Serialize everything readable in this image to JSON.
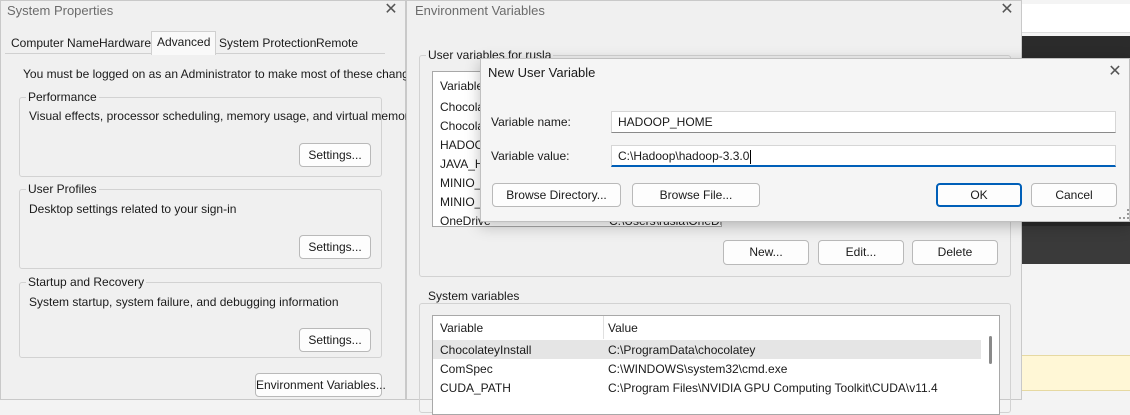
{
  "system_properties": {
    "title": "System Properties",
    "tabs": [
      "Computer Name",
      "Hardware",
      "Advanced",
      "System Protection",
      "Remote"
    ],
    "admin_note": "You must be logged on as an Administrator to make most of these changes.",
    "performance": {
      "title": "Performance",
      "desc": "Visual effects, processor scheduling, memory usage, and virtual memory",
      "button": "Settings..."
    },
    "user_profiles": {
      "title": "User Profiles",
      "desc": "Desktop settings related to your sign-in",
      "button": "Settings..."
    },
    "startup_recovery": {
      "title": "Startup and Recovery",
      "desc": "System startup, system failure, and debugging information",
      "button": "Settings..."
    },
    "env_button": "Environment Variables..."
  },
  "env_vars": {
    "title": "Environment Variables",
    "user_group_title": "User variables for rusla",
    "user_header": "Variable",
    "user_rows": [
      "Chocola",
      "Chocola",
      "HADOO",
      "JAVA_H",
      "MINIO_",
      "MINIO_",
      "OneDrive"
    ],
    "user_last_value": "C:\\Users\\rusla\\OneDrive",
    "buttons": {
      "new": "New...",
      "edit": "Edit...",
      "delete": "Delete"
    },
    "system_group_title": "System variables",
    "system_headers": {
      "variable": "Variable",
      "value": "Value"
    },
    "system_rows": [
      {
        "variable": "ChocolateyInstall",
        "value": "C:\\ProgramData\\chocolatey"
      },
      {
        "variable": "ComSpec",
        "value": "C:\\WINDOWS\\system32\\cmd.exe"
      },
      {
        "variable": "CUDA_PATH",
        "value": "C:\\Program Files\\NVIDIA GPU Computing Toolkit\\CUDA\\v11.4"
      }
    ]
  },
  "new_user_variable": {
    "title": "New User Variable",
    "name_label": "Variable name:",
    "name_value": "HADOOP_HOME",
    "value_label": "Variable value:",
    "value_value": "C:\\Hadoop\\hadoop-3.3.0",
    "browse_directory": "Browse Directory...",
    "browse_file": "Browse File...",
    "ok": "OK",
    "cancel": "Cancel"
  },
  "close_glyph": "✕",
  "colors": {
    "accent": "#005fb8",
    "selected_row": "#e5e5e5",
    "window_bg": "#f0f0f0"
  }
}
